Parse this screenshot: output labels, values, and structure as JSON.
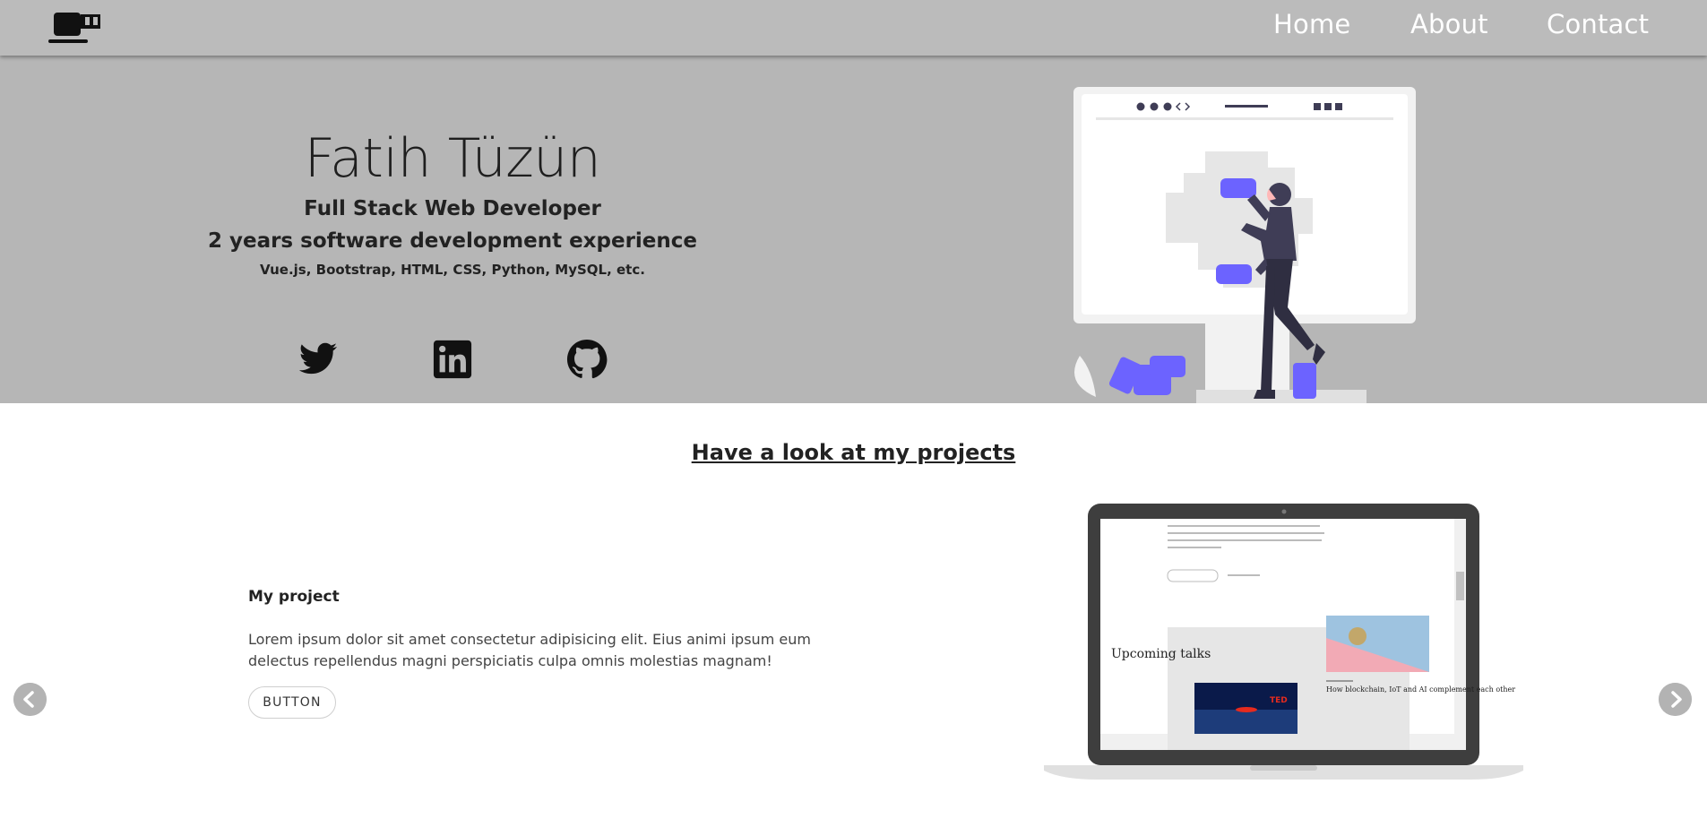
{
  "nav": {
    "logo_icon": "coffee-cup-icon",
    "links": [
      "Home",
      "About",
      "Contact"
    ]
  },
  "hero": {
    "name": "Fatih Tüzün",
    "role": "Full Stack Web Developer",
    "experience": "2 years software development experience",
    "skills": "Vue.js, Bootstrap, HTML, CSS, Python, MySQL, etc.",
    "social_icons": [
      "twitter-icon",
      "linkedin-icon",
      "github-icon"
    ],
    "illustration": "developer-building-website-illustration"
  },
  "projects": {
    "heading": "Have a look at my projects",
    "slides": [
      {
        "title": "My project",
        "description": "Lorem ipsum dolor sit amet consectetur adipisicing elit. Eius animi ipsum eum delectus repellendus magni perspiciatis culpa omnis molestias magnam!",
        "button_label": "BUTTON",
        "screenshot": {
          "section_title": "Upcoming talks",
          "article_title": "How blockchain, IoT and AI complement each other",
          "badge": "TED"
        }
      }
    ],
    "prev_icon": "chevron-left-icon",
    "next_icon": "chevron-right-icon"
  },
  "colors": {
    "navbar_bg": "#bbbbbb",
    "hero_bg": "#b6b6b6",
    "accent_purple": "#6c63ff",
    "dark_figure": "#3f3d56"
  }
}
